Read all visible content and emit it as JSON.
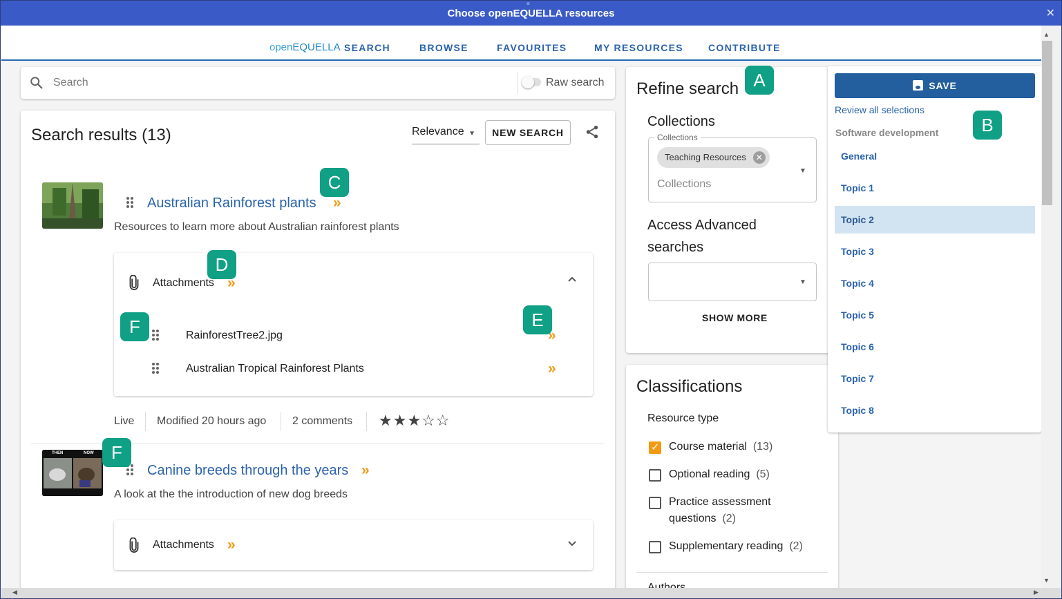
{
  "titlebar": {
    "title": "Choose openEQUELLA resources",
    "close": "✕",
    "grip": "≡"
  },
  "topnav": {
    "logo_open": "open",
    "logo_equella": "EQUELLA",
    "items": [
      "SEARCH",
      "BROWSE",
      "FAVOURITES",
      "MY RESOURCES",
      "CONTRIBUTE"
    ]
  },
  "search": {
    "placeholder": "Search",
    "raw_label": "Raw search",
    "icon": "search-icon"
  },
  "results": {
    "title": "Search results (13)",
    "sort": "Relevance",
    "new_search": "NEW SEARCH",
    "items": [
      {
        "title": "Australian Rainforest plants",
        "description": "Resources to learn more about Australian rainforest plants",
        "attachments_label": "Attachments",
        "attachments": [
          "RainforestTree2.jpg",
          "Australian Tropical Rainforest Plants"
        ],
        "status": "Live",
        "modified": "Modified 20 hours ago",
        "comments": "2 comments",
        "rating": 3,
        "stars": "★★★☆☆"
      },
      {
        "title": "Canine breeds through the years",
        "description": "A look at the the introduction of new dog breeds",
        "attachments_label": "Attachments",
        "thumb_text_left": "THEN",
        "thumb_text_right": "NOW"
      }
    ]
  },
  "refine": {
    "title": "Refine search",
    "collections_heading": "Collections",
    "collections_legend": "Collections",
    "collections_chip": "Teaching Resources",
    "collections_placeholder": "Collections",
    "advanced_line1": "Access Advanced",
    "advanced_line2": "searches",
    "show_more": "SHOW MORE"
  },
  "classifications": {
    "title": "Classifications",
    "resource_type": "Resource type",
    "options": [
      {
        "label": "Course material",
        "count": "(13)",
        "checked": true
      },
      {
        "label": "Optional reading",
        "count": "(5)",
        "checked": false
      },
      {
        "label_line1": "Practice assessment",
        "label_line2": "questions",
        "count": "(2)",
        "checked": false
      },
      {
        "label": "Supplementary reading",
        "count": "(2)",
        "checked": false
      }
    ],
    "authors": "Authors"
  },
  "selection": {
    "save": "SAVE",
    "review": "Review all selections",
    "group": "Software development",
    "topics": [
      "General",
      "Topic 1",
      "Topic 2",
      "Topic 3",
      "Topic 4",
      "Topic 5",
      "Topic 6",
      "Topic 7",
      "Topic 8"
    ],
    "active_topic": "Topic 2"
  },
  "badges": [
    "A",
    "B",
    "C",
    "D",
    "E",
    "F",
    "F"
  ],
  "colors": {
    "accent": "#2a63ad",
    "brand_bar": "#3a5bc7",
    "chevron": "#f39a11",
    "badge": "#0fa085"
  }
}
